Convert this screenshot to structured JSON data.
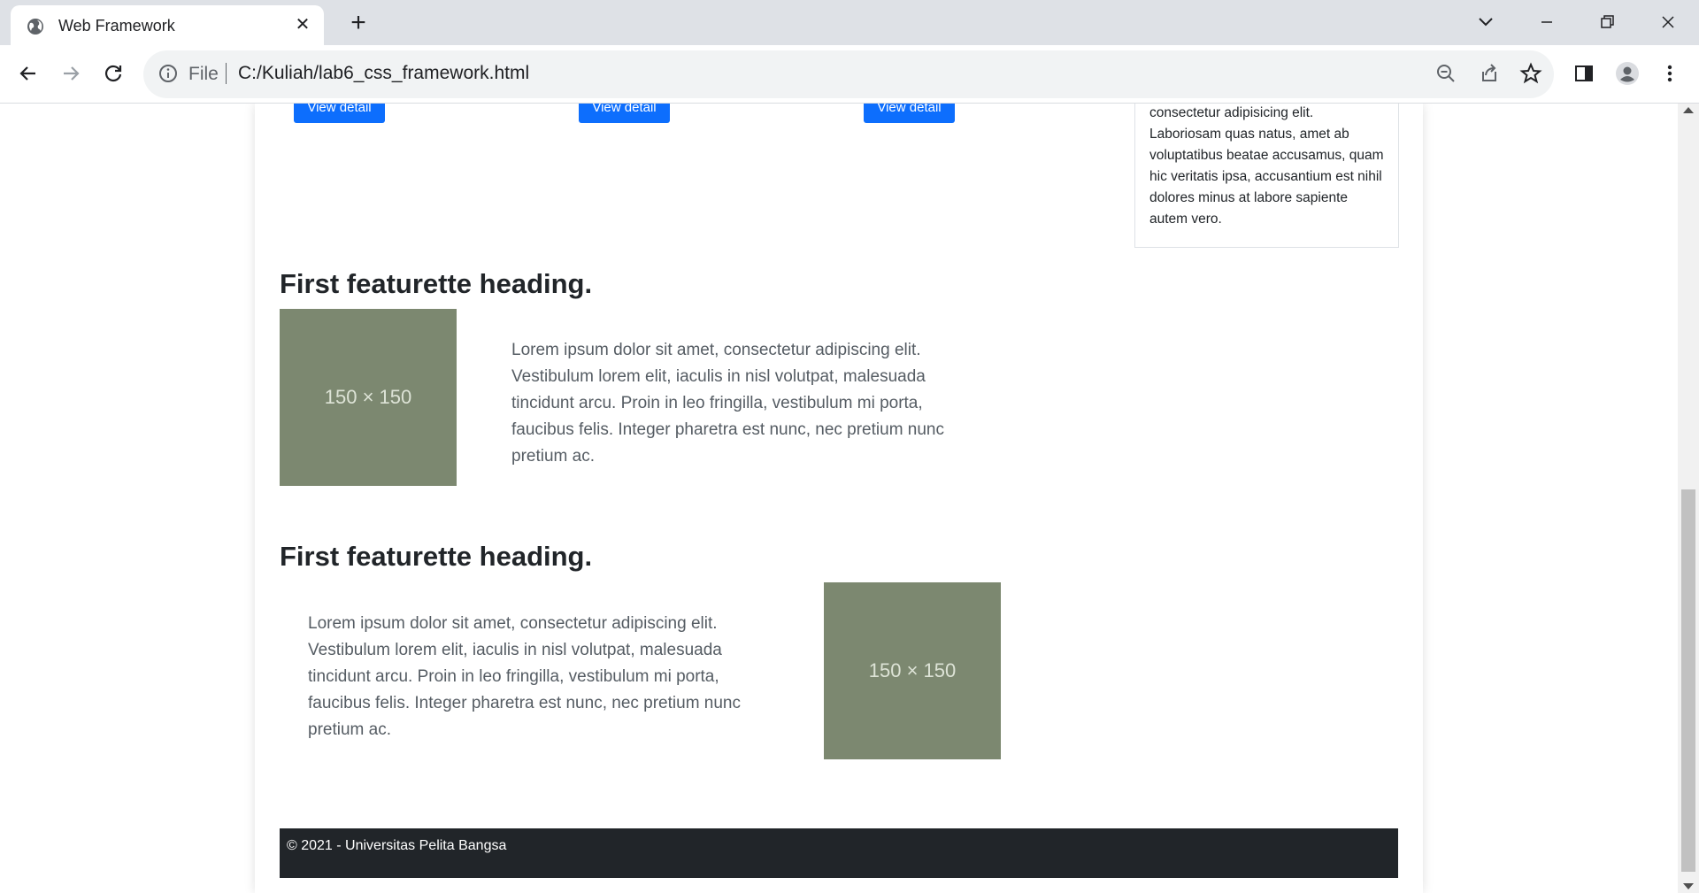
{
  "browser": {
    "tab_title": "Web Framework",
    "tab_close": "✕",
    "new_tab": "+",
    "omnibox_file_label": "File",
    "url": "C:/Kuliah/lab6_css_framework.html"
  },
  "page": {
    "cards": [
      {
        "button": "View detail"
      },
      {
        "button": "View detail"
      },
      {
        "button": "View detail"
      }
    ],
    "sidebar_text": "consectetur adipisicing elit. Laboriosam quas natus, amet ab voluptatibus beatae accusamus, quam hic veritatis ipsa, accusantium est nihil dolores minus at labore sapiente autem vero.",
    "featurettes": [
      {
        "heading": "First featurette heading.",
        "image_label": "150 × 150",
        "text": "Lorem ipsum dolor sit amet, consectetur adipiscing elit. Vestibulum lorem elit, iaculis in nisl volutpat, malesuada tincidunt arcu. Proin in leo fringilla, vestibulum mi porta, faucibus felis. Integer pharetra est nunc, nec pretium nunc pretium ac."
      },
      {
        "heading": "First featurette heading.",
        "image_label": "150 × 150",
        "text": "Lorem ipsum dolor sit amet, consectetur adipiscing elit. Vestibulum lorem elit, iaculis in nisl volutpat, malesuada tincidunt arcu. Proin in leo fringilla, vestibulum mi porta, faucibus felis. Integer pharetra est nunc, nec pretium nunc pretium ac."
      }
    ],
    "footer": "© 2021 - Universitas Pelita Bangsa"
  },
  "colors": {
    "primary": "#0d6efd",
    "placeholder": "#7c8870",
    "footer": "#212529"
  },
  "icons": [
    "globe-icon",
    "close-icon",
    "plus-icon",
    "chevron-down-icon",
    "minimize-icon",
    "restore-icon",
    "close-window-icon",
    "back-icon",
    "forward-icon",
    "reload-icon",
    "info-icon",
    "zoom-out-icon",
    "share-icon",
    "star-icon",
    "side-panel-icon",
    "profile-icon",
    "menu-dots-icon"
  ]
}
